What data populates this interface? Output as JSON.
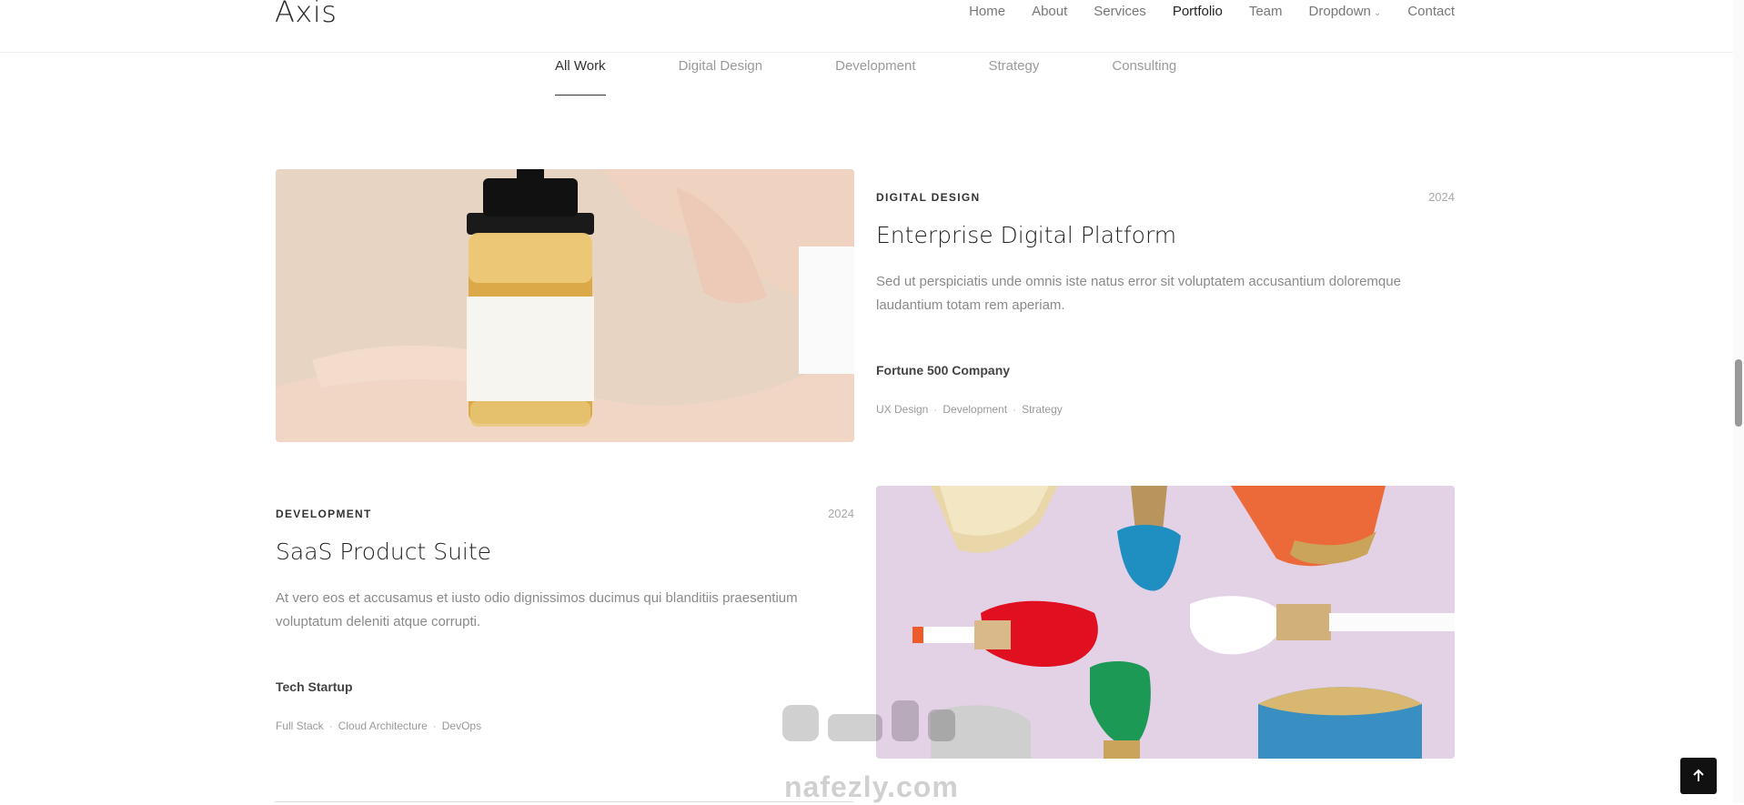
{
  "header": {
    "logo": "Axis",
    "nav": [
      "Home",
      "About",
      "Services",
      "Portfolio",
      "Team",
      "Dropdown",
      "Contact"
    ],
    "active_nav": "Portfolio"
  },
  "filters": {
    "items": [
      "All Work",
      "Digital Design",
      "Development",
      "Strategy",
      "Consulting"
    ],
    "active": "All Work"
  },
  "projects": [
    {
      "category": "DIGITAL DESIGN",
      "year": "2024",
      "title": "Enterprise Digital Platform",
      "description": "Sed ut perspiciatis unde omnis iste natus error sit voluptatem accusantium doloremque laudantium totam rem aperiam.",
      "client": "Fortune 500 Company",
      "tags": [
        "UX Design",
        "Development",
        "Strategy"
      ]
    },
    {
      "category": "DEVELOPMENT",
      "year": "2024",
      "title": "SaaS Product Suite",
      "description": "At vero eos et accusamus et iusto odio dignissimos ducimus qui blanditiis praesentium voluptatum deleniti atque corrupti.",
      "client": "Tech Startup",
      "tags": [
        "Full Stack",
        "Cloud Architecture",
        "DevOps"
      ]
    }
  ],
  "watermark": {
    "text": "nafezly.com"
  },
  "colors": {
    "accent": "#111111",
    "muted": "#8a8a8a",
    "image1_bg": "#e8d6c6",
    "image2_bg": "#e4d3e6"
  },
  "icons": {
    "scroll_top": "arrow-up-icon",
    "dropdown": "chevron-down-icon"
  }
}
